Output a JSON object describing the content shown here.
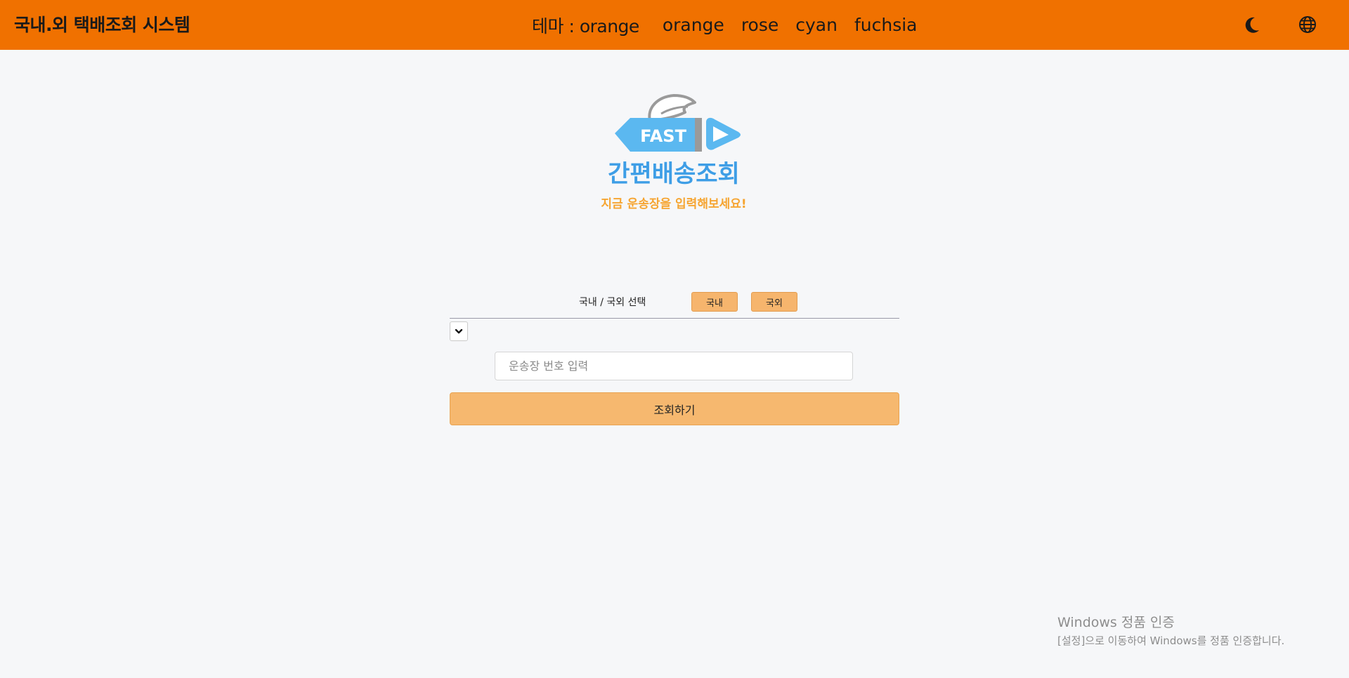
{
  "header": {
    "app_title": "국내.외 택배조회 시스템",
    "theme_label": "테마 : orange",
    "theme_options": [
      "orange",
      "rose",
      "cyan",
      "fuchsia"
    ],
    "icons": [
      "moon-icon",
      "globe-icon"
    ]
  },
  "logo": {
    "badge_text": "FAST",
    "title": "간편배송조회",
    "subtitle": "지금 운송장을 입력해보세요!",
    "colors": {
      "blue": "#5bb8f0",
      "orange": "#f6a531",
      "wing": "#9a9a9a"
    }
  },
  "form": {
    "region_label": "국내 / 국외 선택",
    "domestic_label": "국내",
    "international_label": "국외",
    "tracking_placeholder": "운송장 번호 입력",
    "submit_label": "조회하기"
  },
  "watermark": {
    "title": "Windows 정품 인증",
    "subtitle": "[설정]으로 이동하여 Windows를 정품 인증합니다."
  },
  "colors": {
    "header_bg": "#f07100",
    "button_bg": "#f6b56d",
    "page_bg": "#f6f7f9"
  }
}
